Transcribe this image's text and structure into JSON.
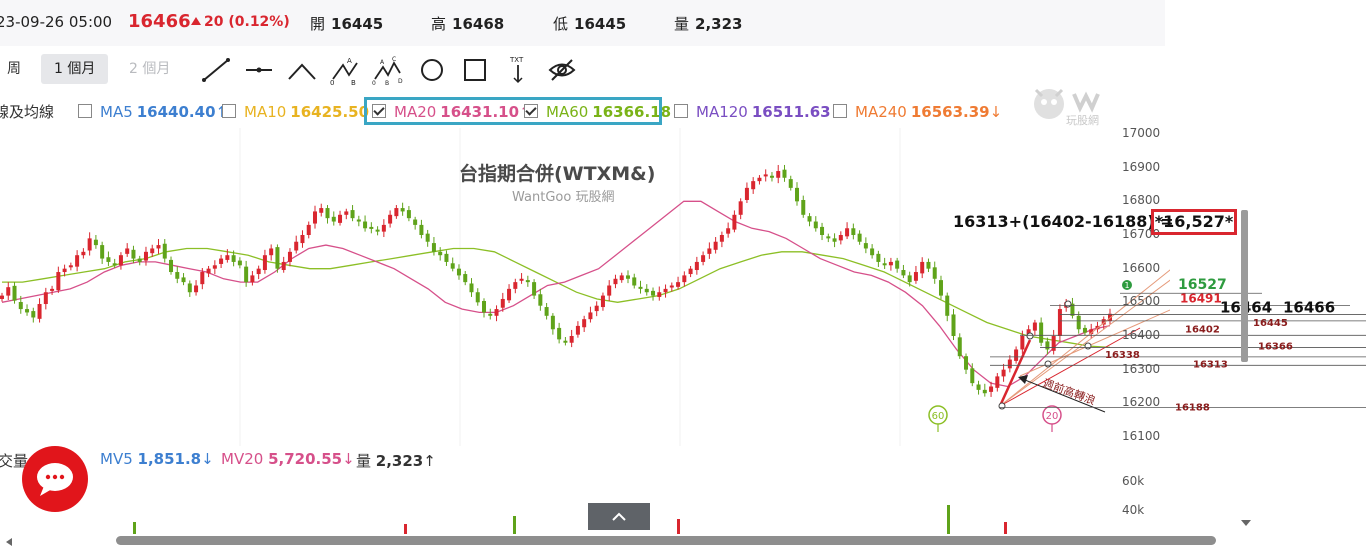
{
  "header": {
    "datetime": "23-09-26 05:00",
    "price": "16466",
    "change": "20 (0.12%)",
    "open_label": "開",
    "open": "16445",
    "high_label": "高",
    "high": "16468",
    "low_label": "低",
    "low": "16445",
    "volume_label": "量",
    "volume": "2,323"
  },
  "toolbar": {
    "tf_week": "周",
    "tf_month": "1 個月",
    "tf_2month": "2 個月",
    "tools": [
      "line-tool-icon",
      "horizontal-line-icon",
      "wedge-icon",
      "abc-pattern-icon",
      "abcd-pattern-icon",
      "circle-icon",
      "rectangle-icon",
      "text-marker-icon",
      "hide-drawings-icon"
    ],
    "abc_letters": {
      "a": "A",
      "b": "B",
      "c": "C",
      "d": "D",
      "o": "0"
    },
    "txt_label": "TXT"
  },
  "ma_row": {
    "prefix": "線及均線",
    "items": [
      {
        "name": "MA5",
        "value": "16440.40",
        "arrow": "↑",
        "checked": false,
        "color": "#3d7fd0"
      },
      {
        "name": "MA10",
        "value": "16425.50",
        "arrow": "↑",
        "checked": false,
        "color": "#e8b321"
      },
      {
        "name": "MA20",
        "value": "16431.10",
        "arrow": "↑",
        "checked": true,
        "color": "#d6508a"
      },
      {
        "name": "MA60",
        "value": "16366.18",
        "arrow": "↓",
        "checked": true,
        "color": "#7ab317"
      },
      {
        "name": "MA120",
        "value": "16511.63",
        "arrow": "↓",
        "checked": false,
        "color": "#7a4ec2"
      },
      {
        "name": "MA240",
        "value": "16563.39",
        "arrow": "↓",
        "checked": false,
        "color": "#ef7b33"
      }
    ]
  },
  "watermark": {
    "title": "台指期合併(WTXM&)",
    "subtitle": "WantGoo 玩股網",
    "logo_text": "玩股網"
  },
  "chart_data": {
    "type": "candlestick",
    "title": "台指期合併(WTXM&)",
    "y_ticks": [
      17000,
      16900,
      16800,
      16700,
      16600,
      16500,
      16400,
      16300,
      16200,
      16100
    ],
    "ylim": [
      16100,
      17000
    ],
    "candles": [
      16520,
      16545,
      16505,
      16480,
      16470,
      16455,
      16495,
      16530,
      16540,
      16590,
      16600,
      16610,
      16640,
      16650,
      16690,
      16670,
      16630,
      16620,
      16610,
      16640,
      16660,
      16630,
      16620,
      16650,
      16660,
      16670,
      16630,
      16590,
      16570,
      16560,
      16530,
      16550,
      16590,
      16600,
      16610,
      16630,
      16640,
      16620,
      16610,
      16560,
      16580,
      16600,
      16640,
      16660,
      16600,
      16620,
      16650,
      16680,
      16700,
      16730,
      16770,
      16780,
      16750,
      16740,
      16760,
      16770,
      16750,
      16740,
      16720,
      16720,
      16710,
      16730,
      16760,
      16780,
      16770,
      16750,
      16730,
      16700,
      16680,
      16650,
      16640,
      16620,
      16600,
      16580,
      16560,
      16530,
      16500,
      16470,
      16460,
      16480,
      16510,
      16540,
      16560,
      16570,
      16560,
      16520,
      16490,
      16460,
      16420,
      16390,
      16380,
      16400,
      16430,
      16450,
      16470,
      16490,
      16520,
      16550,
      16570,
      16580,
      16570,
      16550,
      16540,
      16530,
      16520,
      16530,
      16540,
      16550,
      16560,
      16580,
      16600,
      16620,
      16640,
      16660,
      16680,
      16700,
      16720,
      16760,
      16800,
      16840,
      16860,
      16870,
      16880,
      16870,
      16890,
      16870,
      16840,
      16800,
      16760,
      16740,
      16720,
      16700,
      16690,
      16680,
      16700,
      16720,
      16700,
      16680,
      16660,
      16640,
      16620,
      16610,
      16620,
      16600,
      16580,
      16560,
      16590,
      16620,
      16600,
      16570,
      16520,
      16460,
      16400,
      16340,
      16300,
      16260,
      16240,
      16230,
      16250,
      16280,
      16300,
      16330,
      16360,
      16400,
      16420,
      16440,
      16380,
      16360,
      16400,
      16480,
      16500,
      16460,
      16420,
      16410,
      16420,
      16430,
      16450,
      16466
    ],
    "ma20": [
      16500,
      16510,
      16520,
      16530,
      16540,
      16560,
      16590,
      16610,
      16620,
      16620,
      16610,
      16600,
      16590,
      16570,
      16560,
      16560,
      16590,
      16630,
      16660,
      16670,
      16660,
      16640,
      16620,
      16600,
      16570,
      16540,
      16500,
      16480,
      16470,
      16470,
      16490,
      16520,
      16550,
      16560,
      16580,
      16600,
      16640,
      16680,
      16720,
      16760,
      16800,
      16800,
      16770,
      16740,
      16720,
      16710,
      16690,
      16660,
      16630,
      16610,
      16590,
      16580,
      16560,
      16530,
      16490,
      16430,
      16360,
      16300,
      16260,
      16250,
      16280,
      16330,
      16380,
      16400,
      16420,
      16431
    ],
    "ma60": [
      16560,
      16560,
      16570,
      16580,
      16590,
      16600,
      16620,
      16630,
      16650,
      16660,
      16660,
      16650,
      16640,
      16620,
      16610,
      16600,
      16600,
      16610,
      16620,
      16630,
      16640,
      16650,
      16660,
      16660,
      16650,
      16620,
      16590,
      16560,
      16530,
      16510,
      16500,
      16510,
      16520,
      16540,
      16570,
      16600,
      16620,
      16640,
      16650,
      16650,
      16640,
      16630,
      16610,
      16590,
      16560,
      16530,
      16500,
      16470,
      16440,
      16420,
      16400,
      16390,
      16380,
      16370,
      16366
    ],
    "annotations": {
      "formula": "16313+(16402-16188) =",
      "target": "*16,527*",
      "level_16527": "16527",
      "level_16491": "16491",
      "level_16464": "16464",
      "level_16466": "16466",
      "level_16445": "16445",
      "level_16402": "16402",
      "level_16366": "16366",
      "level_16338": "16338",
      "level_16313": "16313",
      "level_16188": "16188",
      "note": "週前高轉浪",
      "marker_60": "60",
      "marker_20": "20",
      "marker_1": "1"
    },
    "horizontal_levels": [
      16527,
      16491,
      16464,
      16445,
      16402,
      16366,
      16338,
      16313,
      16188
    ]
  },
  "volume_row": {
    "label": "交量",
    "mv5_label": "MV5",
    "mv5": "1,851.8",
    "mv5_arrow": "↓",
    "mv20_label": "MV20",
    "mv20": "5,720.55",
    "mv20_arrow": "↓",
    "vol_label": "量",
    "vol": "2,323",
    "vol_arrow": "↑",
    "y_ticks": [
      "60k",
      "40k"
    ]
  },
  "colors": {
    "up": "#d9262f",
    "down": "#5fa31a",
    "accent": "#3aa6c4",
    "target_box": "#d9262f"
  }
}
